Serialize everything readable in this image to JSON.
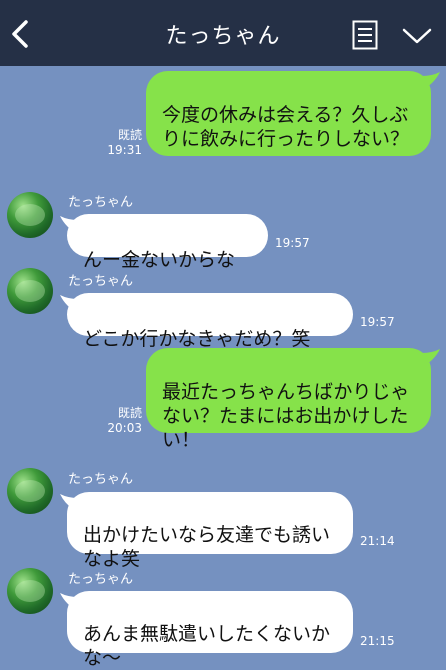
{
  "header": {
    "title": "たっちゃん"
  },
  "icons": [
    "back-arrow-icon",
    "menu-icon",
    "chevron-down-icon"
  ],
  "colors": {
    "header_bg": "#253046",
    "chat_bg": "#7591c0",
    "sent_bubble": "#86e24a",
    "received_bubble": "#ffffff"
  },
  "messages": [
    {
      "from": "me",
      "text": "今度の休みは会える？久しぶりに飲みに行ったりしない？",
      "read": "既読",
      "time": "19:31"
    },
    {
      "from": "them",
      "sender": "たっちゃん",
      "text": "んー金ないからな",
      "time": "19:57"
    },
    {
      "from": "them",
      "sender": "たっちゃん",
      "text": "どこか行かなきゃだめ？笑",
      "time": "19:57"
    },
    {
      "from": "me",
      "text": "最近たっちゃんちばかりじゃない？たまにはお出かけしたい！",
      "read": "既読",
      "time": "20:03"
    },
    {
      "from": "them",
      "sender": "たっちゃん",
      "text": "出かけたいなら友達でも誘いなよ笑",
      "time": "21:14"
    },
    {
      "from": "them",
      "sender": "たっちゃん",
      "text": "あんま無駄遣いしたくないかな〜",
      "time": "21:15"
    }
  ]
}
